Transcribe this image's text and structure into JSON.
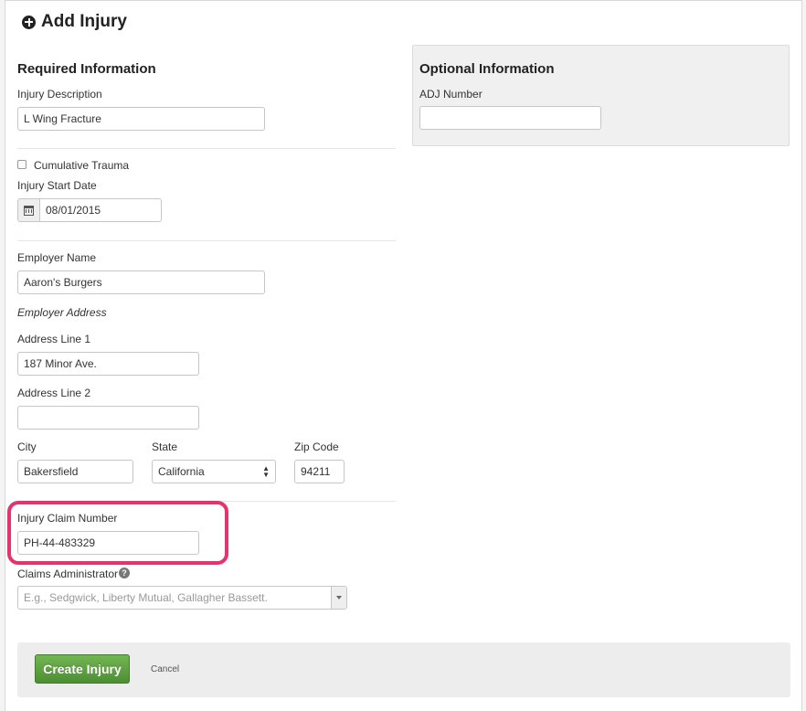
{
  "header": {
    "title": "Add Injury",
    "icon": "plus-circle-icon"
  },
  "required": {
    "heading": "Required Information",
    "injury_description": {
      "label": "Injury Description",
      "value": "L Wing Fracture"
    },
    "cumulative_trauma": {
      "label": "Cumulative Trauma",
      "checked": false
    },
    "injury_start_date": {
      "label": "Injury Start Date",
      "value": "08/01/2015",
      "icon": "calendar-icon"
    },
    "employer_name": {
      "label": "Employer Name",
      "value": "Aaron's Burgers"
    },
    "employer_address_heading": "Employer Address",
    "address_line_1": {
      "label": "Address Line 1",
      "value": "187 Minor Ave."
    },
    "address_line_2": {
      "label": "Address Line 2",
      "value": ""
    },
    "city": {
      "label": "City",
      "value": "Bakersfield"
    },
    "state": {
      "label": "State",
      "value": "California"
    },
    "zip": {
      "label": "Zip Code",
      "value": "94211"
    },
    "injury_claim_number": {
      "label": "Injury Claim Number",
      "value": "PH-44-483329"
    },
    "claims_administrator": {
      "label": "Claims Administrator",
      "placeholder": "E.g., Sedgwick, Liberty Mutual, Gallagher Bassett."
    }
  },
  "optional": {
    "heading": "Optional Information",
    "adj_number": {
      "label": "ADJ Number",
      "value": ""
    }
  },
  "footer": {
    "create_label": "Create Injury",
    "cancel_label": "Cancel"
  },
  "colors": {
    "highlight": "#e8326e",
    "create_button": "#5a9e3e"
  }
}
